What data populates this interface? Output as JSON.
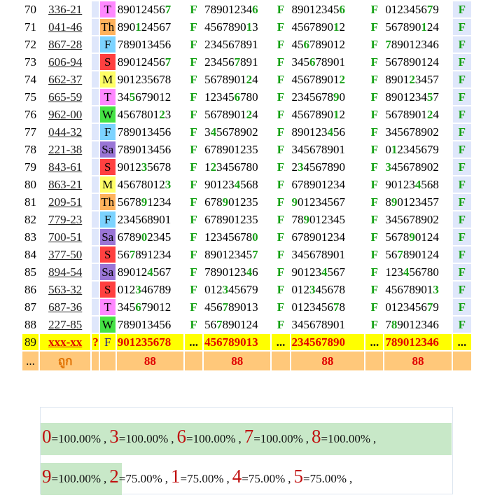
{
  "day_colors": {
    "T": "#ff88ff",
    "Th": "#ffb25c",
    "F": "#7cd3ff",
    "S": "#ff4040",
    "M": "#ffff66",
    "W": "#44e244",
    "Sa": "#9a75d6"
  },
  "rows": [
    {
      "n": "70",
      "code": "336-21",
      "day": "T",
      "nums": [
        "890124567",
        "789012346",
        "890123456",
        "012345679"
      ],
      "flags": [
        "F",
        "F",
        "F",
        "F"
      ],
      "hl": [
        [
          8
        ],
        [
          8
        ],
        [
          8
        ],
        [
          7
        ]
      ]
    },
    {
      "n": "71",
      "code": "041-46",
      "day": "Th",
      "nums": [
        "890124567",
        "456789013",
        "456789012",
        "567890124"
      ],
      "flags": [
        "F",
        "F",
        "F",
        "F"
      ],
      "hl": [
        [
          3
        ],
        [
          7
        ],
        [
          7
        ],
        [
          6
        ]
      ]
    },
    {
      "n": "72",
      "code": "867-28",
      "day": "F",
      "nums": [
        "789013456",
        "234567891",
        "456789012",
        "789012346"
      ],
      "flags": [
        "F",
        "F",
        "F",
        "F"
      ],
      "hl": [
        [],
        [],
        [
          2
        ],
        [
          0
        ]
      ]
    },
    {
      "n": "73",
      "code": "606-94",
      "day": "S",
      "nums": [
        "890124567",
        "234567891",
        "345678901",
        "567890124"
      ],
      "flags": [
        "F",
        "F",
        "F",
        "F"
      ],
      "hl": [
        [
          8
        ],
        [
          5
        ],
        [
          3
        ],
        []
      ]
    },
    {
      "n": "74",
      "code": "662-37",
      "day": "M",
      "nums": [
        "901235678",
        "567890124",
        "456789012",
        "890123457"
      ],
      "flags": [
        "F",
        "F",
        "F",
        "F"
      ],
      "hl": [
        [],
        [
          7
        ],
        [
          8
        ],
        [
          4
        ]
      ]
    },
    {
      "n": "75",
      "code": "665-59",
      "day": "T",
      "nums": [
        "345679012",
        "123456780",
        "234567890",
        "890123457"
      ],
      "flags": [
        "F",
        "F",
        "F",
        "F"
      ],
      "hl": [
        [
          2
        ],
        [
          5
        ],
        [
          7
        ],
        [
          7
        ]
      ]
    },
    {
      "n": "76",
      "code": "962-00",
      "day": "W",
      "nums": [
        "456780123",
        "567890124",
        "456789012",
        "567890124"
      ],
      "flags": [
        "F",
        "F",
        "F",
        "F"
      ],
      "hl": [
        [
          7
        ],
        [
          7
        ],
        [
          7
        ],
        [
          7
        ]
      ]
    },
    {
      "n": "77",
      "code": "044-32",
      "day": "F",
      "nums": [
        "789013456",
        "345678902",
        "890123456",
        "345678902"
      ],
      "flags": [
        "F",
        "F",
        "F",
        "F"
      ],
      "hl": [
        [],
        [
          1
        ],
        [
          6
        ],
        []
      ]
    },
    {
      "n": "78",
      "code": "221-38",
      "day": "Sa",
      "nums": [
        "789013456",
        "678901235",
        "345678901",
        "012345679"
      ],
      "flags": [
        "F",
        "F",
        "F",
        "F"
      ],
      "hl": [
        [],
        [],
        [],
        [
          1
        ]
      ]
    },
    {
      "n": "79",
      "code": "843-61",
      "day": "S",
      "nums": [
        "901235678",
        "123456780",
        "234567890",
        "345678902"
      ],
      "flags": [
        "F",
        "F",
        "F",
        "F"
      ],
      "hl": [
        [
          4
        ],
        [
          1
        ],
        [
          1
        ],
        [
          0
        ]
      ]
    },
    {
      "n": "80",
      "code": "863-21",
      "day": "M",
      "nums": [
        "456780123",
        "901234568",
        "678901234",
        "901234568"
      ],
      "flags": [
        "F",
        "F",
        "F",
        "F"
      ],
      "hl": [
        [
          8
        ],
        [
          5
        ],
        [],
        [
          5
        ]
      ]
    },
    {
      "n": "81",
      "code": "209-51",
      "day": "Th",
      "nums": [
        "567891234",
        "678901235",
        "901234567",
        "890123457"
      ],
      "flags": [
        "F",
        "F",
        "F",
        "F"
      ],
      "hl": [
        [
          4
        ],
        [
          3
        ],
        [
          0
        ],
        [
          1
        ]
      ]
    },
    {
      "n": "82",
      "code": "779-23",
      "day": "F",
      "nums": [
        "234568901",
        "678901235",
        "789012345",
        "345678902"
      ],
      "flags": [
        "F",
        "F",
        "F",
        "F"
      ],
      "hl": [
        [],
        [],
        [
          2
        ],
        []
      ]
    },
    {
      "n": "83",
      "code": "700-51",
      "day": "Sa",
      "nums": [
        "678902345",
        "123456780",
        "678901234",
        "567890124"
      ],
      "flags": [
        "F",
        "F",
        "F",
        "F"
      ],
      "hl": [
        [
          4
        ],
        [
          8
        ],
        [],
        [
          4
        ]
      ]
    },
    {
      "n": "84",
      "code": "377-50",
      "day": "S",
      "nums": [
        "567891234",
        "890123457",
        "345678901",
        "567890124"
      ],
      "flags": [
        "F",
        "F",
        "F",
        "F"
      ],
      "hl": [
        [
          2
        ],
        [
          8
        ],
        [],
        [
          2
        ]
      ]
    },
    {
      "n": "85",
      "code": "894-54",
      "day": "Sa",
      "nums": [
        "890124567",
        "789012346",
        "901234567",
        "123456780"
      ],
      "flags": [
        "F",
        "F",
        "F",
        "F"
      ],
      "hl": [
        [
          5
        ],
        [
          7
        ],
        [
          5
        ],
        [
          3
        ]
      ]
    },
    {
      "n": "86",
      "code": "563-32",
      "day": "S",
      "nums": [
        "012346789",
        "012345679",
        "012345678",
        "456789013"
      ],
      "flags": [
        "F",
        "F",
        "F",
        "F"
      ],
      "hl": [
        [
          3
        ],
        [
          3
        ],
        [
          3
        ],
        [
          8
        ]
      ]
    },
    {
      "n": "87",
      "code": "687-36",
      "day": "T",
      "nums": [
        "345679012",
        "456789013",
        "012345678",
        "012345679"
      ],
      "flags": [
        "F",
        "F",
        "F",
        "F"
      ],
      "hl": [
        [
          3
        ],
        [
          3
        ],
        [
          7
        ],
        [
          7
        ]
      ]
    },
    {
      "n": "88",
      "code": "227-85",
      "day": "W",
      "nums": [
        "789013456",
        "567890124",
        "345678901",
        "789012346"
      ],
      "flags": [
        "F",
        "F",
        "F",
        "F"
      ],
      "hl": [
        [],
        [
          2
        ],
        [],
        [
          1
        ]
      ]
    }
  ],
  "prediction": {
    "n": "89",
    "code": "xxx-xx",
    "q": "?",
    "day": "F",
    "nums": [
      "901235678",
      "456789013",
      "234567890",
      "789012346"
    ],
    "dots": [
      "...",
      "...",
      "...",
      "..."
    ]
  },
  "summary": {
    "lead": "...",
    "label": "ถูก",
    "counts": [
      "88",
      "88",
      "88",
      "88"
    ]
  },
  "stats": {
    "line1": [
      {
        "digit": "0",
        "pct": "=100.00%"
      },
      {
        "digit": "3",
        "pct": "=100.00%"
      },
      {
        "digit": "6",
        "pct": "=100.00%"
      },
      {
        "digit": "7",
        "pct": "=100.00%"
      },
      {
        "digit": "8",
        "pct": "=100.00%"
      }
    ],
    "line2": [
      {
        "digit": "9",
        "pct": "=100.00%"
      },
      {
        "digit": "2",
        "pct": "=75.00%"
      },
      {
        "digit": "1",
        "pct": "=75.00%"
      },
      {
        "digit": "4",
        "pct": "=75.00%"
      },
      {
        "digit": "5",
        "pct": "=75.00%"
      }
    ],
    "separator": ","
  }
}
